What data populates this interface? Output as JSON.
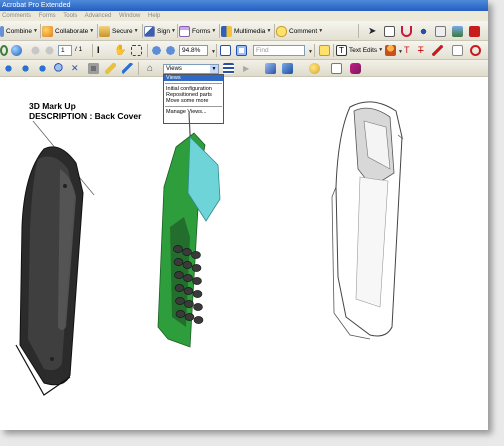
{
  "window": {
    "title": "Acrobat Pro Extended"
  },
  "menu": [
    "Comments",
    "Forms",
    "Tools",
    "Advanced",
    "Window",
    "Help"
  ],
  "toolbar1": {
    "combine": "Combine",
    "collaborate": "Collaborate",
    "secure": "Secure",
    "sign": "Sign",
    "forms": "Forms",
    "multimedia": "Multimedia",
    "comment": "Comment"
  },
  "toolbar2": {
    "page_current": "1",
    "page_total": "/ 1",
    "zoom": "94.8%",
    "find_placeholder": "Find",
    "text_edits": "Text Edits"
  },
  "views": {
    "selected": "Views",
    "options": [
      "Views",
      "Initial configuration",
      "Repositioned parts",
      "Move some more",
      "Manage Views..."
    ]
  },
  "caption": {
    "line1": "3D Mark Up",
    "line2": "DESCRIPTION : Back Cover"
  },
  "colors": {
    "title_bar": "#245ec2",
    "highlight": "#316ac5",
    "pcb_green": "#2e9e3d",
    "screen_cyan": "#6fd4d8",
    "case_dark": "#2a2a2a"
  },
  "icons": [
    "file-icon",
    "users-icon",
    "lock-icon",
    "pen-icon",
    "form-icon",
    "film-icon",
    "speech-icon",
    "hand-icon",
    "zoom-icon"
  ]
}
